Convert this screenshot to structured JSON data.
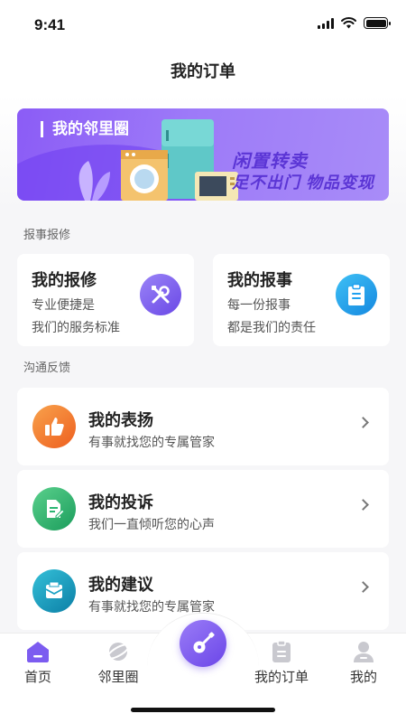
{
  "status_bar": {
    "time": "9:41"
  },
  "nav": {
    "title": "我的订单"
  },
  "banner": {
    "label": "我的邻里圈",
    "slogan_line1": "闲置转卖",
    "slogan_line2": "足不出门  物品变现",
    "colors": {
      "start": "#8b5cf6",
      "end": "#a88cf8",
      "slogan": "#5b35d5"
    }
  },
  "sections": {
    "report": {
      "title": "报事报修",
      "cards": [
        {
          "title": "我的报修",
          "line1": "专业便捷是",
          "line2": "我们的服务标准",
          "icon": "wrench-screwdriver-icon",
          "color": "#7c5cf0"
        },
        {
          "title": "我的报事",
          "line1": "每一份报事",
          "line2": "都是我们的责任",
          "icon": "clipboard-icon",
          "color": "#1ea0f0"
        }
      ]
    },
    "feedback": {
      "title": "沟通反馈",
      "items": [
        {
          "title": "我的表扬",
          "subtitle": "有事就找您的专属管家",
          "icon": "thumbs-up-icon",
          "color": "#f27a2c"
        },
        {
          "title": "我的投诉",
          "subtitle": "我们一直倾听您的心声",
          "icon": "document-edit-icon",
          "color": "#2bb673"
        },
        {
          "title": "我的建议",
          "subtitle": "有事就找您的专属管家",
          "icon": "envelope-icon",
          "color": "#1aa1c4"
        }
      ]
    }
  },
  "tabbar": {
    "tabs": [
      {
        "label": "首页",
        "icon": "home-icon",
        "active": true
      },
      {
        "label": "邻里圈",
        "icon": "planet-icon",
        "active": false
      },
      {
        "label": "我的订单",
        "icon": "order-icon",
        "active": false
      },
      {
        "label": "我的",
        "icon": "profile-icon",
        "active": false
      }
    ],
    "center_icon": "guitar-icon",
    "accent": "#7c5cf0"
  }
}
